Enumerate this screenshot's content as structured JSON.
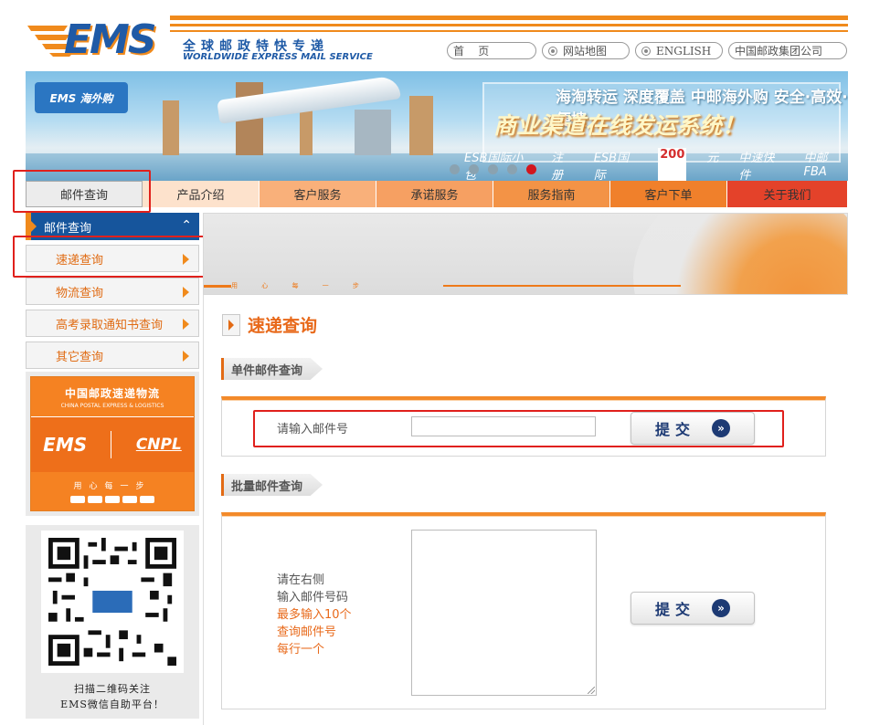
{
  "header": {
    "logo": "EMS",
    "tagline_cn": "全球邮政特快专递",
    "tagline_en": "WORLDWIDE EXPRESS MAIL SERVICE",
    "links": [
      {
        "label": "首    页"
      },
      {
        "label": "网站地图"
      },
      {
        "label": "ENGLISH"
      },
      {
        "label": "中国邮政集团公司"
      }
    ]
  },
  "banner": {
    "logo_text": "EMS 海外购",
    "line1": "海淘转运  深度覆盖  中邮海外购  安全·高效·便捷",
    "line2": "商业渠道在线发运系统！",
    "tags": [
      "ESB国际小包",
      "注册",
      "ESB国际",
      "200",
      "元",
      "中速快件",
      "中邮FBA"
    ]
  },
  "nav": {
    "items": [
      {
        "label": "邮件查询",
        "bg": "#ececec"
      },
      {
        "label": "产品介绍",
        "bg": "#fde2cc"
      },
      {
        "label": "客户服务",
        "bg": "#f9b07a"
      },
      {
        "label": "承诺服务",
        "bg": "#f6a062"
      },
      {
        "label": "服务指南",
        "bg": "#f39346"
      },
      {
        "label": "客户下单",
        "bg": "#f0802b"
      },
      {
        "label": "关于我们",
        "bg": "#e4422a"
      }
    ]
  },
  "sidebar": {
    "header": "邮件查询",
    "items": [
      {
        "label": "速递查询"
      },
      {
        "label": "物流查询"
      },
      {
        "label": "高考录取通知书查询"
      },
      {
        "label": "其它查询"
      }
    ],
    "cnpl": {
      "title": "中国邮政速递物流",
      "subtitle": "CHINA POSTAL EXPRESS & LOGISTICS",
      "ems": "EMS",
      "cnpl": "CNPL",
      "slogan": "用心每一步"
    },
    "qr_caption_1": "扫描二维码关注",
    "qr_caption_2": "EMS微信自助平台！"
  },
  "main": {
    "banner_slogan": "用 心 每 一 步",
    "title": "速递查询",
    "single": {
      "tab": "单件邮件查询",
      "label": "请输入邮件号",
      "input_value": "",
      "submit": "提交"
    },
    "batch": {
      "tab": "批量邮件查询",
      "hint_gray_1": "请在右侧",
      "hint_gray_2": "输入邮件号码",
      "hint_orange_1": "最多输入10个",
      "hint_orange_2": "查询邮件号",
      "hint_orange_3": "每行一个",
      "textarea_value": "",
      "submit": "提交"
    }
  },
  "colors": {
    "accent_orange": "#f08a1c",
    "brand_blue": "#16559c",
    "highlight_red": "#e0201c"
  }
}
